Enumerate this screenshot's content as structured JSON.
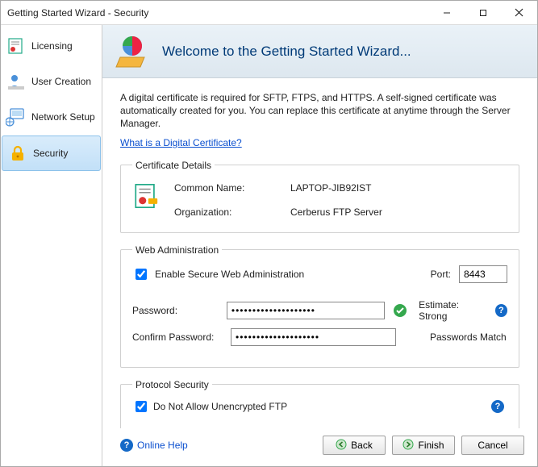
{
  "titlebar": {
    "title": "Getting Started Wizard - Security"
  },
  "sidebar": {
    "items": [
      {
        "label": "Licensing"
      },
      {
        "label": "User Creation"
      },
      {
        "label": "Network Setup"
      },
      {
        "label": "Security"
      }
    ]
  },
  "banner": {
    "title": "Welcome to the Getting Started Wizard..."
  },
  "intro": {
    "text": "A digital certificate is required for SFTP, FTPS, and HTTPS.  A self-signed certificate was automatically created for you.  You can replace this certificate at anytime through the Server Manager.",
    "link": "What is a Digital Certificate?"
  },
  "cert": {
    "legend": "Certificate Details",
    "common_name_label": "Common Name:",
    "common_name_value": "LAPTOP-JIB92IST",
    "organization_label": "Organization:",
    "organization_value": "Cerberus FTP Server"
  },
  "webadmin": {
    "legend": "Web Administration",
    "enable_label": "Enable Secure Web Administration",
    "enable_checked": true,
    "port_label": "Port:",
    "port_value": "8443",
    "password_label": "Password:",
    "password_value": "••••••••••••••••••••",
    "confirm_label": "Confirm Password:",
    "confirm_value": "••••••••••••••••••••",
    "estimate_label": "Estimate: Strong",
    "match_label": "Passwords Match"
  },
  "protocol": {
    "legend": "Protocol Security",
    "unencrypted_label": "Do Not Allow Unencrypted FTP",
    "unencrypted_checked": true
  },
  "footer": {
    "online_help": "Online Help",
    "back": "Back",
    "finish": "Finish",
    "cancel": "Cancel"
  }
}
